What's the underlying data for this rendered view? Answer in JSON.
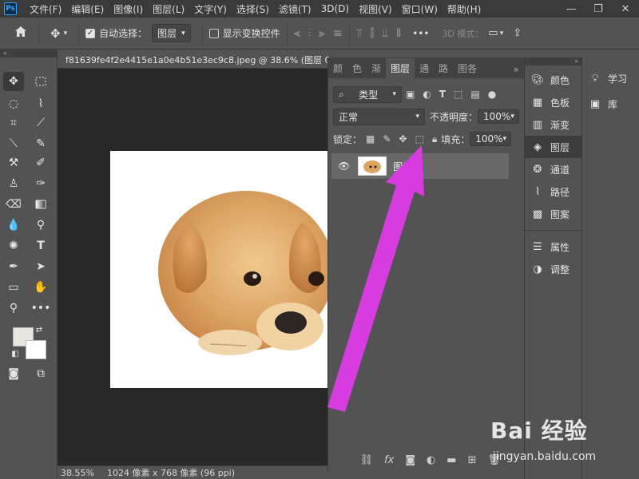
{
  "menubar": {
    "logo": "Ps",
    "items": [
      "文件(F)",
      "编辑(E)",
      "图像(I)",
      "图层(L)",
      "文字(Y)",
      "选择(S)",
      "滤镜(T)",
      "3D(D)",
      "视图(V)",
      "窗口(W)",
      "帮助(H)"
    ],
    "controls": [
      "—",
      "❐",
      "✕"
    ]
  },
  "options": {
    "auto_select_label": "自动选择：",
    "auto_select_value": "图层",
    "show_transform_label": "显示变换控件",
    "more": "•••",
    "mode_3d": "3D 模式："
  },
  "document": {
    "tab_title": "f81639fe4f2e4415e1a0e4b51e3ec9c8.jpeg @ 38.6% (图层 0, R",
    "zoom": "38.55%",
    "size_info": "1024 像素 x 768 像素 (96 ppi)"
  },
  "layers_panel": {
    "tabs": [
      "颜",
      "色",
      "渐",
      "图层",
      "通",
      "路",
      "图各"
    ],
    "active_tab": "图层",
    "filter_type": "类型",
    "blend_mode": "正常",
    "opacity_label": "不透明度：",
    "opacity_value": "100%",
    "lock_label": "锁定：",
    "fill_label": "填充：",
    "fill_value": "100%",
    "layer_name": "图层"
  },
  "dock1": {
    "items": [
      {
        "label": "颜色",
        "icon": "palette-icon"
      },
      {
        "label": "色板",
        "icon": "swatches-icon"
      },
      {
        "label": "渐变",
        "icon": "gradient-icon"
      },
      {
        "label": "图层",
        "icon": "layers-icon"
      },
      {
        "label": "通道",
        "icon": "channels-icon"
      },
      {
        "label": "路径",
        "icon": "paths-icon"
      },
      {
        "label": "图案",
        "icon": "pattern-icon"
      },
      {
        "label": "属性",
        "icon": "properties-icon"
      },
      {
        "label": "调整",
        "icon": "adjustments-icon"
      }
    ]
  },
  "dock2": {
    "items": [
      {
        "label": "学习",
        "icon": "learn-icon"
      },
      {
        "label": "库",
        "icon": "libraries-icon"
      }
    ]
  },
  "watermark": {
    "text": "Bai 经验",
    "url": "jingyan.baidu.com"
  },
  "colors": {
    "annotation_arrow": "#d63ce0",
    "panel_bg": "#535353",
    "canvas_bg": "#282828"
  }
}
